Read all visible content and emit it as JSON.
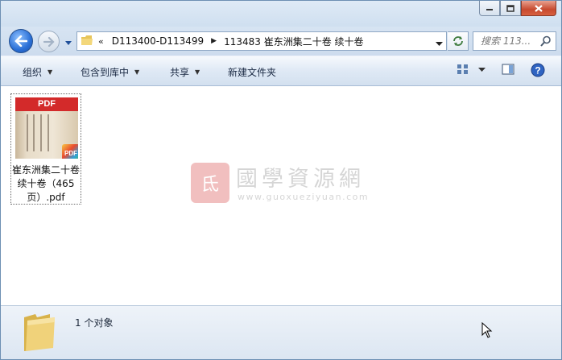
{
  "navigation": {
    "breadcrumb_prefix": "«",
    "breadcrumbs": [
      "D113400-D113499",
      "113483 崔东洲集二十卷 续十卷"
    ],
    "search_placeholder": "搜索 113..."
  },
  "toolbar": {
    "organize": "组织",
    "include_in_library": "包含到库中",
    "share": "共享",
    "new_folder": "新建文件夹"
  },
  "files": [
    {
      "name": "崔东洲集二十卷 续十卷（465页）.pdf",
      "type_label": "PDF",
      "badge": "PDF"
    }
  ],
  "watermark": {
    "seal": "氐",
    "title": "國學資源網",
    "url": "www.guoxueziyuan.com"
  },
  "status": {
    "count_text": "1 个对象"
  },
  "colors": {
    "accent": "#2a6fd6",
    "pdf_red": "#d32a2a",
    "close_red": "#c74a2f"
  }
}
